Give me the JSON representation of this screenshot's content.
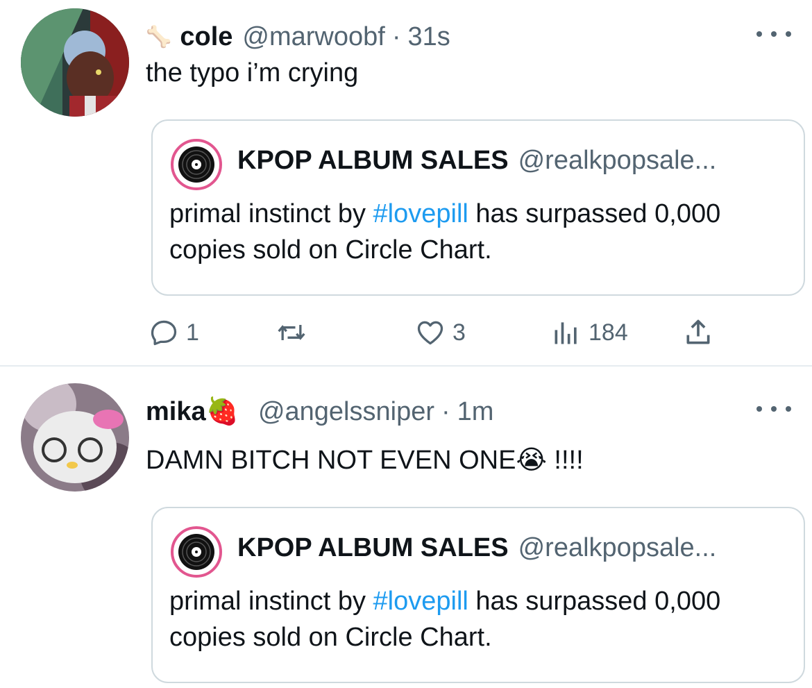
{
  "tweets": [
    {
      "emoji_prefix": "🦴",
      "name": "cole",
      "handle": "@marwoobf",
      "separator": "·",
      "time": "31s",
      "text": "the typo i’m crying",
      "quote": {
        "name": "KPOP ALBUM SALES",
        "handle": "@realkpopsale...",
        "text_before": "primal instinct by ",
        "hashtag": "#lovepill",
        "text_after": " has surpassed 0,000 copies sold on Circle Chart."
      },
      "actions": {
        "reply_count": "1",
        "retweet_count": "",
        "like_count": "3",
        "views_count": "184"
      }
    },
    {
      "name": "mika🍓",
      "handle": "@angelssniper",
      "separator": "·",
      "time": "1m",
      "text": "DAMN BITCH NOT EVEN ONE😭 !!!!",
      "quote": {
        "name": "KPOP ALBUM SALES",
        "handle": "@realkpopsale...",
        "text_before": "primal instinct by ",
        "hashtag": "#lovepill",
        "text_after": " has surpassed 0,000 copies sold on Circle Chart."
      }
    }
  ],
  "colors": {
    "accent": "#1d9bf0",
    "secondary_text": "#536471",
    "border": "#cfd9de",
    "quote_avatar_ring": "#e2568f"
  },
  "icons": [
    "more-icon",
    "reply-icon",
    "retweet-icon",
    "like-icon",
    "views-icon",
    "share-icon"
  ]
}
